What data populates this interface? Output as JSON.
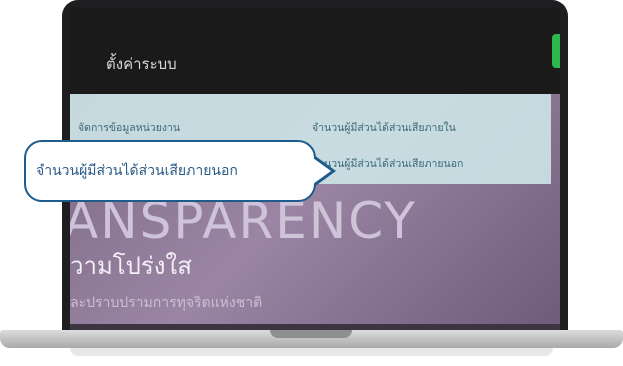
{
  "topbar": {
    "title": "ตั้งค่าระบบ"
  },
  "menu": {
    "items": [
      {
        "label": "จัดการข้อมูลหน่วยงาน"
      },
      {
        "label": "จำนวนผู้มีส่วนได้ส่วนเสียภายใน"
      },
      {
        "label": "จำนวนผู้มีส่วนได้ส่วนเสียภายนอก"
      }
    ]
  },
  "hero": {
    "big_text": "ANSPARENCY",
    "subtitle": "วามโปร่งใส",
    "line": "ละปราบปรามการทุจริตแห่งชาติ"
  },
  "callout": {
    "text": "จำนวนผู้มีส่วนได้ส่วนเสียภายนอก"
  },
  "colors": {
    "accent": "#1d5c8c",
    "menu_text": "#3a6a78",
    "green_button": "#2db84d"
  }
}
